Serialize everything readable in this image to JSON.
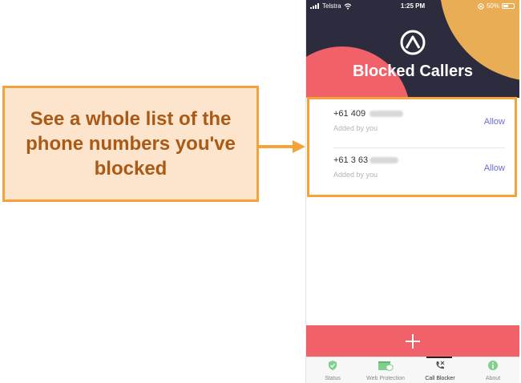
{
  "annotation": {
    "callout_text": "See a whole list of the phone numbers you've blocked",
    "colors": {
      "border": "#f5a23a",
      "fill": "#fde4cc",
      "text": "#a85a16"
    }
  },
  "status_bar": {
    "carrier": "Telstra",
    "time": "1:25 PM",
    "battery": "50%",
    "battery_level": 0.5
  },
  "header": {
    "title": "Blocked Callers",
    "logo_icon": "avast-logo-icon",
    "colors": {
      "background": "#2c2c3e",
      "red": "#f0616a",
      "yellow": "#e9ae55"
    }
  },
  "blocked_list": [
    {
      "number": "+61 409",
      "subtitle": "Added by you",
      "action": "Allow"
    },
    {
      "number": "+61 3 63",
      "subtitle": "Added by you",
      "action": "Allow"
    }
  ],
  "add_button": {
    "icon": "plus-icon",
    "color": "#f0616a"
  },
  "tabs": [
    {
      "label": "Status",
      "icon": "shield-check-icon",
      "active": false
    },
    {
      "label": "Web Protection",
      "icon": "browser-shield-icon",
      "active": false
    },
    {
      "label": "Call Blocker",
      "icon": "phone-blocked-icon",
      "active": true
    },
    {
      "label": "About",
      "icon": "info-icon",
      "active": false
    }
  ]
}
